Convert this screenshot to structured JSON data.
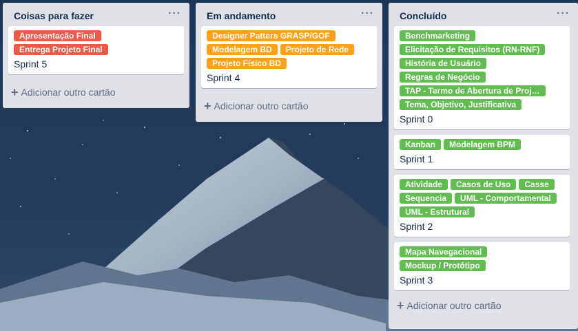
{
  "colors": {
    "orange": "#ff9f1a",
    "red": "#eb5a46",
    "green": "#61bd4f"
  },
  "lists": [
    {
      "title": "Coisas para fazer",
      "menu": "···",
      "add_label": "Adicionar outro cartão",
      "cards": [
        {
          "title": "Sprint 5",
          "labels": [
            {
              "text": "Apresentação Final",
              "color": "red"
            },
            {
              "text": "Entrega Projeto Final",
              "color": "red"
            }
          ]
        }
      ]
    },
    {
      "title": "Em andamento",
      "menu": "···",
      "add_label": "Adicionar outro cartão",
      "cards": [
        {
          "title": "Sprint 4",
          "labels": [
            {
              "text": "Designer Patters GRASP/GOF",
              "color": "orange"
            },
            {
              "text": "Modelagem BD",
              "color": "orange"
            },
            {
              "text": "Projeto de Rede",
              "color": "orange"
            },
            {
              "text": "Projeto Físico BD",
              "color": "orange"
            }
          ]
        }
      ]
    },
    {
      "title": "Concluído",
      "menu": "···",
      "add_label": "Adicionar outro cartão",
      "cards": [
        {
          "title": "Sprint 0",
          "labels": [
            {
              "text": "Benchmarketing",
              "color": "green"
            },
            {
              "text": "Elicitação de Requisitos (RN-RNF)",
              "color": "green"
            },
            {
              "text": "História de Usuário",
              "color": "green"
            },
            {
              "text": "Regras de Negócio",
              "color": "green"
            },
            {
              "text": "TAP - Termo de Abertura de Proj…",
              "color": "green"
            },
            {
              "text": "Tema, Objetivo, Justificativa",
              "color": "green"
            }
          ]
        },
        {
          "title": "Sprint 1",
          "labels": [
            {
              "text": "Kanban",
              "color": "green"
            },
            {
              "text": "Modelagem BPM",
              "color": "green"
            }
          ]
        },
        {
          "title": "Sprint 2",
          "labels": [
            {
              "text": "Atividade",
              "color": "green"
            },
            {
              "text": "Casos de Uso",
              "color": "green"
            },
            {
              "text": "Casse",
              "color": "green"
            },
            {
              "text": "Sequencia",
              "color": "green"
            },
            {
              "text": "UML - Comportamental",
              "color": "green"
            },
            {
              "text": "UML - Estrutural",
              "color": "green"
            }
          ]
        },
        {
          "title": "Sprint 3",
          "labels": [
            {
              "text": "Mapa Navegacional",
              "color": "green"
            },
            {
              "text": "Mockup / Protótipo",
              "color": "green"
            }
          ]
        }
      ]
    }
  ]
}
